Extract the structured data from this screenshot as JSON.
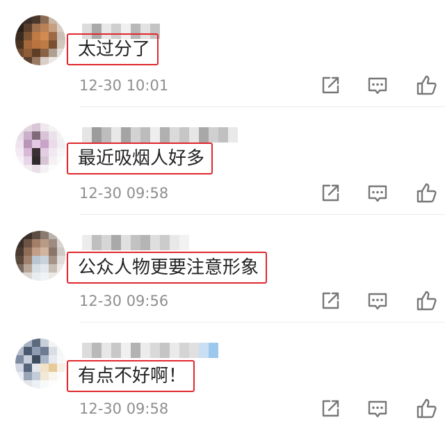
{
  "comments": [
    {
      "text": "太过分了",
      "time": "12-30 10:01"
    },
    {
      "text": "最近吸烟人好多",
      "time": "12-30 09:58"
    },
    {
      "text": "公众人物更要注意形象",
      "time": "12-30 09:56"
    },
    {
      "text": "有点不好啊！",
      "time": "12-30 09:58"
    }
  ],
  "icons": {
    "share": "share-icon",
    "reply": "comment-icon",
    "like": "thumbs-up-icon"
  },
  "colors": {
    "highlight_border": "#e0262b",
    "time_text": "#8e8e8e",
    "icon": "#777777"
  }
}
